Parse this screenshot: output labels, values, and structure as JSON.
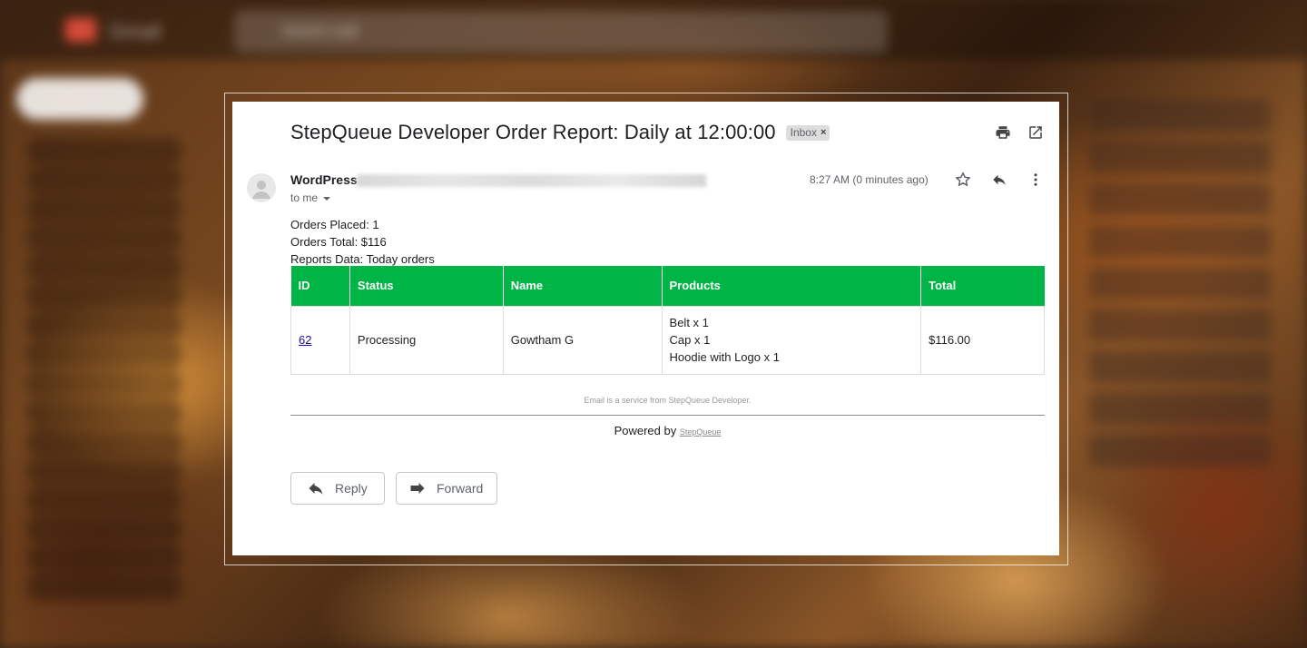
{
  "background": {
    "app_name": "Gmail",
    "search_placeholder": "Search mail"
  },
  "email": {
    "subject": "StepQueue Developer Order Report: Daily at 12:00:00",
    "label_badge": "Inbox",
    "label_remove": "×",
    "sender_name": "WordPress",
    "recipient": "to me",
    "timestamp": "8:27 AM (0 minutes ago)",
    "body_lines": [
      "Orders Placed: 1",
      "Orders Total: $116",
      "Reports Data: Today orders"
    ],
    "table": {
      "headers": [
        "ID",
        "Status",
        "Name",
        "Products",
        "Total"
      ],
      "rows": [
        {
          "id": "62",
          "status": "Processing",
          "name": "Gowtham G",
          "products": [
            "Belt x 1",
            "Cap x 1",
            "Hoodie with Logo x 1"
          ],
          "total": "$116.00"
        }
      ]
    },
    "footnote": "Email is a service from StepQueue Developer.",
    "powered_by_prefix": "Powered by",
    "powered_by_link": "StepQueue"
  },
  "actions": {
    "reply_label": "Reply",
    "forward_label": "Forward"
  },
  "colors": {
    "table_header_bg": "#00b545",
    "link": "#1a0dab"
  },
  "icons": [
    "print-icon",
    "popout-icon",
    "avatar-icon",
    "star-icon",
    "reply-icon",
    "more-vert-icon",
    "reply-arrow-icon",
    "forward-arrow-icon"
  ]
}
